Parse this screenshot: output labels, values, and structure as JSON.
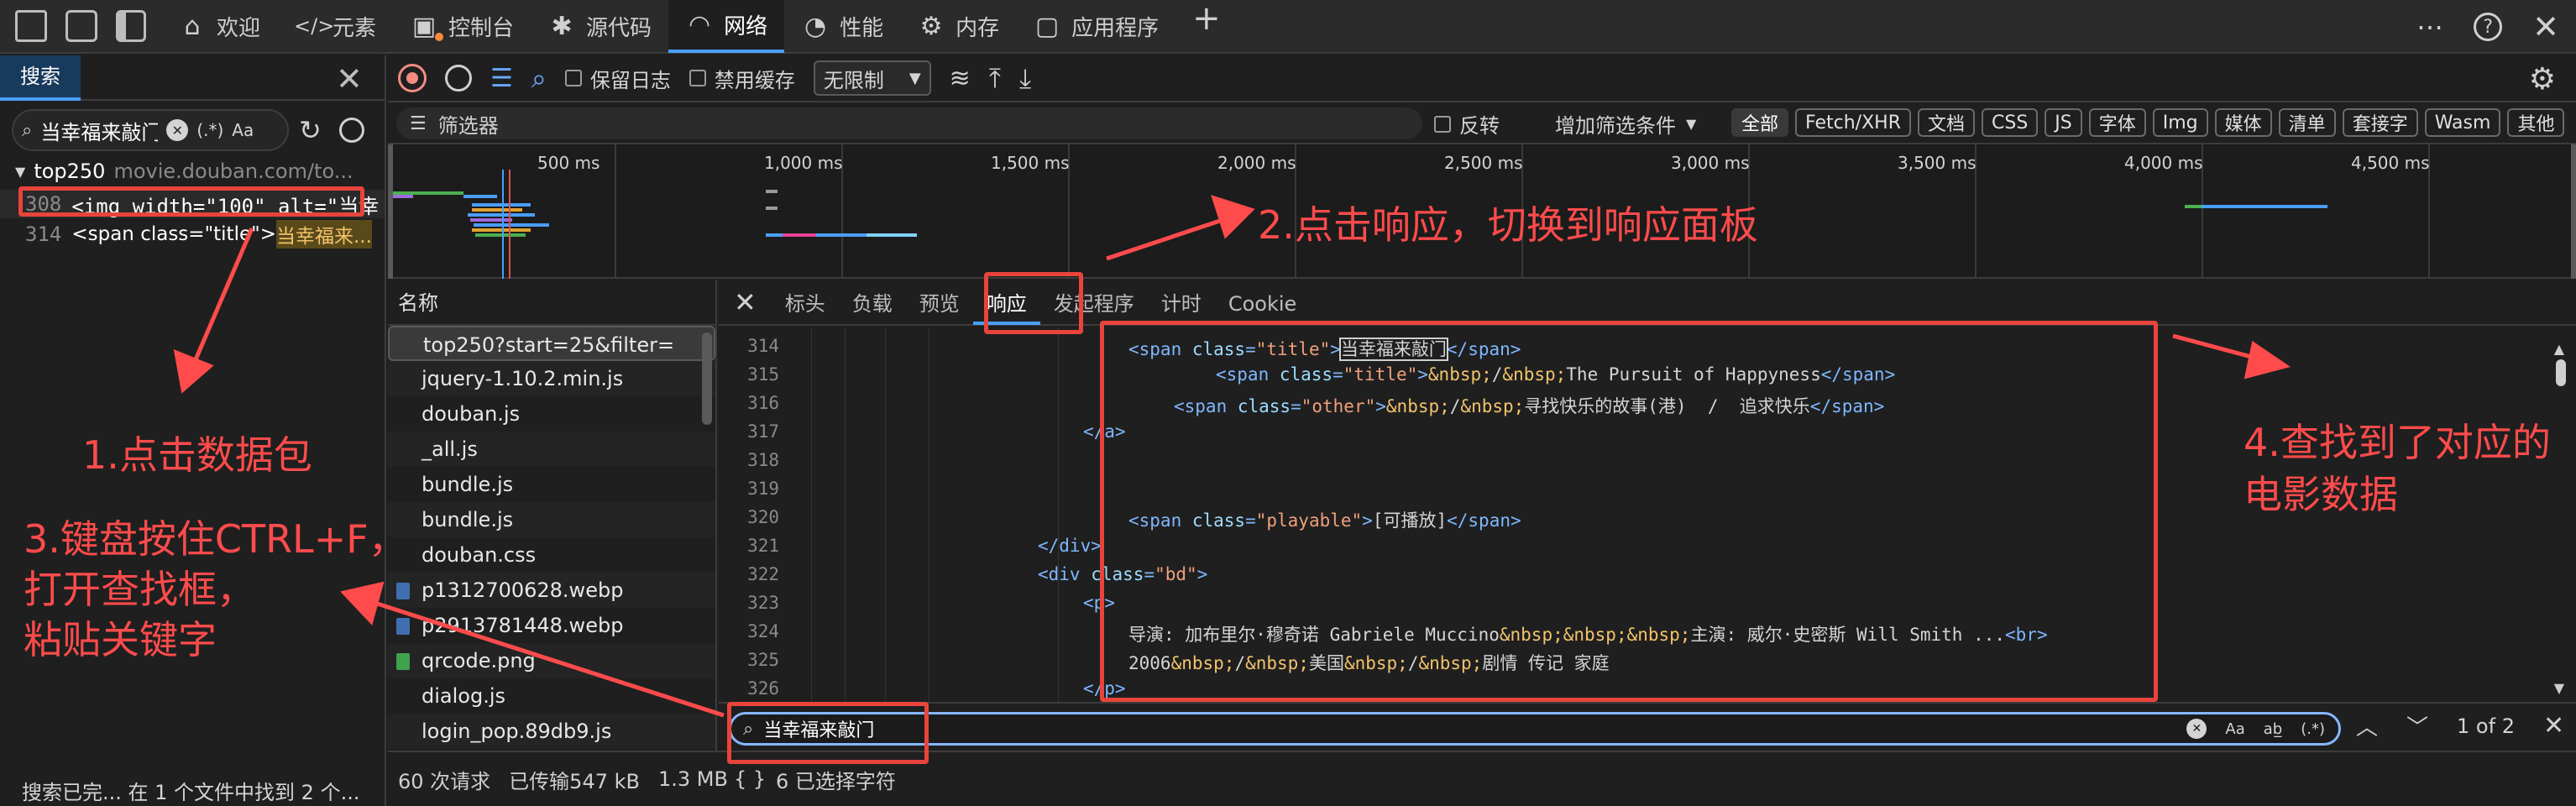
{
  "tabs": [
    {
      "label": "欢迎",
      "icon": "home-icon"
    },
    {
      "label": "元素",
      "icon": "code-icon"
    },
    {
      "label": "控制台",
      "icon": "console-icon"
    },
    {
      "label": "源代码",
      "icon": "bug-icon"
    },
    {
      "label": "网络",
      "icon": "wifi-icon"
    },
    {
      "label": "性能",
      "icon": "gauge-icon"
    },
    {
      "label": "内存",
      "icon": "gear-icon"
    },
    {
      "label": "应用程序",
      "icon": "app-icon"
    }
  ],
  "left_panel": {
    "tab_label": "搜索",
    "search_value": "当幸福来敲门",
    "regex_label": "(.*)",
    "case_label": "Aa",
    "result_file": "top250",
    "result_url": "movie.douban.com/to...",
    "results": [
      {
        "line": "308",
        "text": "<img width=\"100\" alt=\"当幸"
      },
      {
        "line": "314",
        "prefix": "<span class=\"title\">",
        "match": "当幸福来..."
      }
    ],
    "status": "搜索已完... 在 1 个文件中找到 2 个..."
  },
  "toolbar": {
    "preserve_log": "保留日志",
    "disable_cache": "禁用缓存",
    "throttle": "无限制"
  },
  "filter": {
    "placeholder": "筛选器",
    "invert": "反转",
    "more_filters": "增加筛选条件",
    "types": [
      "全部",
      "Fetch/XHR",
      "文档",
      "CSS",
      "JS",
      "字体",
      "Img",
      "媒体",
      "清单",
      "套接字",
      "Wasm",
      "其他"
    ]
  },
  "timeline": {
    "ticks": [
      "500 ms",
      "1,000 ms",
      "1,500 ms",
      "2,000 ms",
      "2,500 ms",
      "3,000 ms",
      "3,500 ms",
      "4,000 ms",
      "4,500 ms"
    ]
  },
  "network": {
    "name_header": "名称",
    "requests": [
      {
        "name": "top250?start=25&filter=",
        "type": "doc"
      },
      {
        "name": "jquery-1.10.2.min.js",
        "type": "js"
      },
      {
        "name": "douban.js",
        "type": "js"
      },
      {
        "name": "_all.js",
        "type": "js"
      },
      {
        "name": "bundle.js",
        "type": "js"
      },
      {
        "name": "bundle.js",
        "type": "js"
      },
      {
        "name": "douban.css",
        "type": "css"
      },
      {
        "name": "p1312700628.webp",
        "type": "img"
      },
      {
        "name": "p2913781448.webp",
        "type": "img"
      },
      {
        "name": "qrcode.png",
        "type": "img-green"
      },
      {
        "name": "dialog.js",
        "type": "js"
      },
      {
        "name": "login_pop.89db9.js",
        "type": "js"
      }
    ]
  },
  "detail": {
    "tabs": [
      "标头",
      "负载",
      "预览",
      "响应",
      "发起程序",
      "计时",
      "Cookie"
    ],
    "active_tab": "响应",
    "code_lines": [
      {
        "n": "314",
        "parts": [
          [
            "tg",
            "<span "
          ],
          [
            "at",
            "class"
          ],
          [
            "tg",
            "="
          ],
          [
            "st",
            "\"title\""
          ],
          [
            "tg",
            ">"
          ],
          [
            "tx",
            "当幸福来敲门"
          ],
          [
            "tg",
            "</span>"
          ]
        ]
      },
      {
        "n": "315",
        "parts": [
          [
            "tg",
            "<span "
          ],
          [
            "at",
            "class"
          ],
          [
            "tg",
            "="
          ],
          [
            "st",
            "\"title\""
          ],
          [
            "tg",
            ">"
          ],
          [
            "en",
            "&nbsp;"
          ],
          [
            "tx",
            "/"
          ],
          [
            "en",
            "&nbsp;"
          ],
          [
            "tx",
            "The Pursuit of Happyness"
          ],
          [
            "tg",
            "</span>"
          ]
        ]
      },
      {
        "n": "316",
        "parts": [
          [
            "tg",
            "<span "
          ],
          [
            "at",
            "class"
          ],
          [
            "tg",
            "="
          ],
          [
            "st",
            "\"other\""
          ],
          [
            "tg",
            ">"
          ],
          [
            "en",
            "&nbsp;"
          ],
          [
            "tx",
            "/"
          ],
          [
            "en",
            "&nbsp;"
          ],
          [
            "tx",
            "寻找快乐的故事(港)  /  追求快乐"
          ],
          [
            "tg",
            "</span>"
          ]
        ]
      },
      {
        "n": "317",
        "parts": [
          [
            "tg",
            "</a>"
          ]
        ]
      },
      {
        "n": "318",
        "parts": []
      },
      {
        "n": "319",
        "parts": []
      },
      {
        "n": "320",
        "parts": [
          [
            "tg",
            "<span "
          ],
          [
            "at",
            "class"
          ],
          [
            "tg",
            "="
          ],
          [
            "st",
            "\"playable\""
          ],
          [
            "tg",
            ">"
          ],
          [
            "tx",
            "[可播放]"
          ],
          [
            "tg",
            "</span>"
          ]
        ]
      },
      {
        "n": "321",
        "parts": [
          [
            "tg",
            "</div>"
          ]
        ]
      },
      {
        "n": "322",
        "parts": [
          [
            "tg",
            "<div "
          ],
          [
            "at",
            "class"
          ],
          [
            "tg",
            "="
          ],
          [
            "st",
            "\"bd\""
          ],
          [
            "tg",
            ">"
          ]
        ]
      },
      {
        "n": "323",
        "parts": [
          [
            "tg",
            "<p>"
          ]
        ]
      },
      {
        "n": "324",
        "parts": [
          [
            "tx",
            "导演: 加布里尔·穆奇诺 Gabriele Muccino"
          ],
          [
            "en",
            "&nbsp;&nbsp;&nbsp;"
          ],
          [
            "tx",
            "主演: 威尔·史密斯 Will Smith ..."
          ],
          [
            "tg",
            "<br>"
          ]
        ]
      },
      {
        "n": "325",
        "parts": [
          [
            "tx",
            "2006"
          ],
          [
            "en",
            "&nbsp;"
          ],
          [
            "tx",
            "/"
          ],
          [
            "en",
            "&nbsp;"
          ],
          [
            "tx",
            "美国"
          ],
          [
            "en",
            "&nbsp;"
          ],
          [
            "tx",
            "/"
          ],
          [
            "en",
            "&nbsp;"
          ],
          [
            "tx",
            "剧情 传记 家庭"
          ]
        ]
      },
      {
        "n": "326",
        "parts": [
          [
            "tg",
            "</p>"
          ]
        ]
      }
    ],
    "find_value": "当幸福来敲门",
    "find_case": "Aa",
    "find_regex": "(.*)",
    "find_count": "1 of 2"
  },
  "status_bar": {
    "requests": "60 次请求",
    "transferred": "已传输547 kB",
    "resources": "1.3 MB",
    "selection": "6 已选择字符",
    "braces": "{ }"
  },
  "annotations": {
    "step1": "1.点击数据包",
    "step2": "2.点击响应，切换到响应面板",
    "step3_line1": "3.键盘按住CTRL+F，",
    "step3_line2": "打开查找框，",
    "step3_line3": "粘贴关键字",
    "step4_line1": "4.查找到了对应的",
    "step4_line2": "电影数据",
    "color": "#ff4b4b"
  }
}
